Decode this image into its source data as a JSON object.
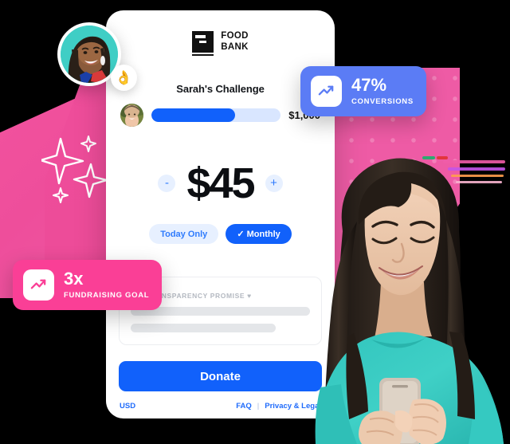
{
  "brand": {
    "logo_icon": "food-bank-logo-icon",
    "name_line1": "FOOD",
    "name_line2": "BANK",
    "accent_blue": "#1161fb",
    "accent_pink": "#fa3f96",
    "accent_periwinkle": "#5b7cf5"
  },
  "challenge": {
    "title": "Sarah's Challenge",
    "avatar_name": "challenge-organizer-avatar",
    "goal_amount": "$1,000",
    "progress_percent": 65
  },
  "amount": {
    "decrement_label": "-",
    "value": "$45",
    "increment_label": "+"
  },
  "frequency": {
    "options": [
      {
        "label": "Today Only",
        "selected": false
      },
      {
        "label": "Monthly",
        "selected": true,
        "check": "✓"
      }
    ]
  },
  "promise": {
    "legend": "+ TRANSPARENCY PROMISE ♥"
  },
  "cta": {
    "donate_label": "Donate"
  },
  "footer": {
    "currency": "USD",
    "faq_label": "FAQ",
    "separator": "|",
    "privacy_label": "Privacy & Legal"
  },
  "badges": [
    {
      "icon": "trending-up-icon",
      "value": "47%",
      "caption": "CONVERSIONS",
      "color": "#5b7cf5"
    },
    {
      "icon": "trending-up-icon",
      "value": "3x",
      "caption": "FUNDRAISING GOAL",
      "color": "#fa3f96"
    }
  ],
  "testimonial": {
    "avatar_name": "supporter-avatar-photo",
    "reaction_emoji": "👌"
  },
  "hero": {
    "person_name": "woman-holding-phone-photo"
  },
  "decor": {
    "sparkles_icon": "sparkles-icon",
    "dots_pattern": "polka-dot-pattern"
  }
}
